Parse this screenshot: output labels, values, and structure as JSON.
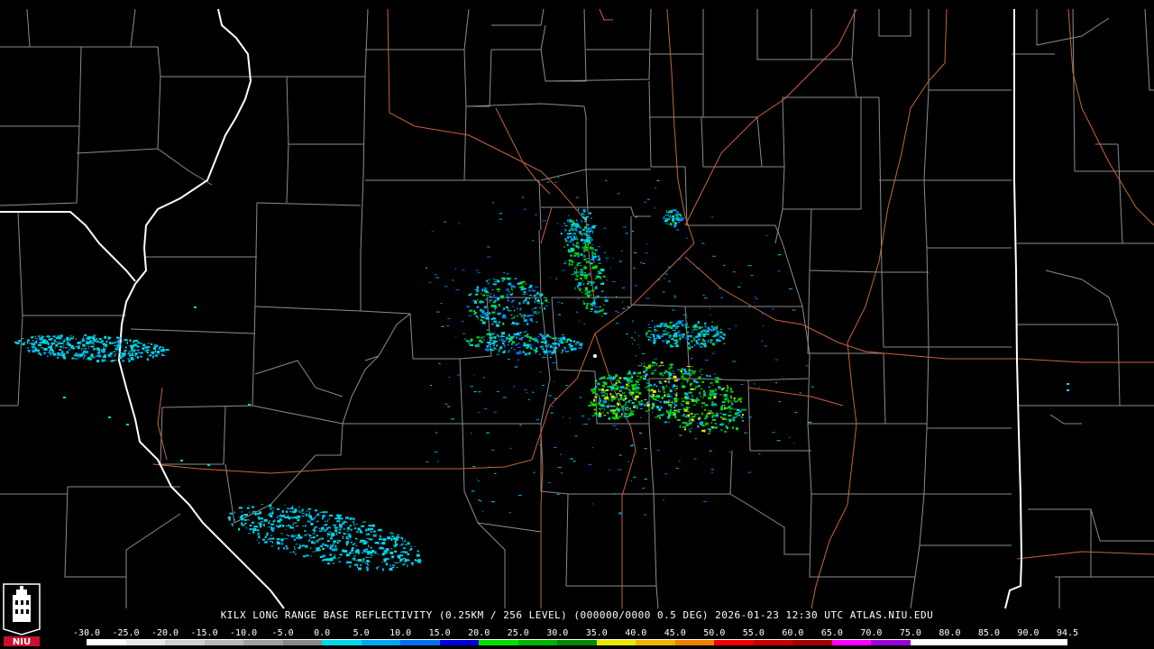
{
  "product": {
    "title": "KILX LONG RANGE BASE REFLECTIVITY (0.25KM / 256 LEVEL) (000000/0000 0.5 DEG) 2026-01-23 12:30 UTC  ATLAS.NIU.EDU"
  },
  "logo": {
    "text": "NIU"
  },
  "colorscale": {
    "labels": [
      "-30.0",
      "-25.0",
      "-20.0",
      "-15.0",
      "-10.0",
      "-5.0",
      "0.0",
      "5.0",
      "10.0",
      "15.0",
      "20.0",
      "25.0",
      "30.0",
      "35.0",
      "40.0",
      "45.0",
      "50.0",
      "55.0",
      "60.0",
      "65.0",
      "70.0",
      "75.0",
      "80.0",
      "85.0",
      "90.0",
      "94.5"
    ],
    "colors": [
      "#ffffff",
      "#e8e8e8",
      "#d0d0d0",
      "#b8b8b8",
      "#a0a0a0",
      "#888888",
      "#00d8e8",
      "#00a8f0",
      "#0070f0",
      "#0000d8",
      "#00e000",
      "#00b400",
      "#008800",
      "#e8e800",
      "#f0b400",
      "#f08000",
      "#f00000",
      "#c80000",
      "#a00000",
      "#ff00ff",
      "#a000d8",
      "#ffffff",
      "#ffffff",
      "#ffffff",
      "#ffffff"
    ],
    "label_color": "#ffffff"
  },
  "map": {
    "background": "#000000",
    "county_line_color": "#8c8c8c",
    "state_line_color": "#ffffff",
    "highway_color": "#c8643c",
    "echo_colors": [
      "#00d8e8",
      "#00a8f0",
      "#0070f0",
      "#00e000",
      "#00b400",
      "#e8e800"
    ]
  }
}
